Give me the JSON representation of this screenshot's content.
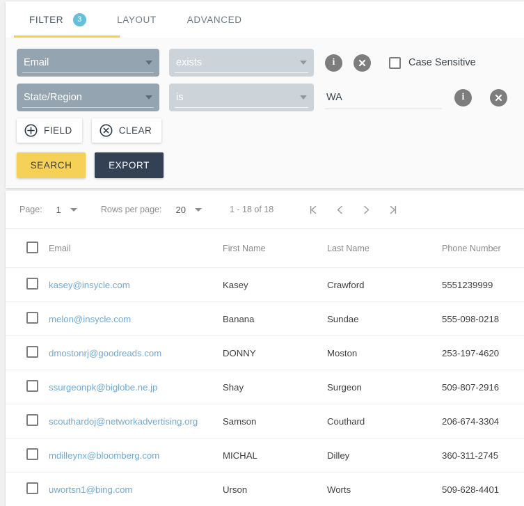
{
  "tabs": [
    {
      "label": "FILTER",
      "badge": "3",
      "active": true
    },
    {
      "label": "LAYOUT",
      "badge": "",
      "active": false
    },
    {
      "label": "ADVANCED",
      "badge": "",
      "active": false
    }
  ],
  "filters": [
    {
      "field": "Email",
      "operator": "exists",
      "value": "",
      "value_placeholder": ""
    },
    {
      "field": "State/Region",
      "operator": "is",
      "value": "WA",
      "value_placeholder": ""
    }
  ],
  "case_sensitive": {
    "label": "Case Sensitive",
    "checked": false
  },
  "buttons": {
    "field": "FIELD",
    "clear": "CLEAR",
    "search": "SEARCH",
    "export": "EXPORT"
  },
  "pagination": {
    "page_label": "Page:",
    "page_value": "1",
    "rows_label": "Rows per page:",
    "rows_value": "20",
    "range": "1 - 18 of 18"
  },
  "table": {
    "headers": [
      "Email",
      "First Name",
      "Last Name",
      "Phone Number"
    ],
    "rows": [
      {
        "email": "kasey@insycle.com",
        "first": "Kasey",
        "last": "Crawford",
        "phone": "5551239999"
      },
      {
        "email": "melon@insycle.com",
        "first": "Banana",
        "last": "Sundae",
        "phone": "555-098-0218"
      },
      {
        "email": "dmostonrj@goodreads.com",
        "first": "DONNY",
        "last": "Moston",
        "phone": "253-197-4620"
      },
      {
        "email": "ssurgeonpk@biglobe.ne.jp",
        "first": "Shay",
        "last": "Surgeon",
        "phone": "509-807-2916"
      },
      {
        "email": "scouthardoj@networkadvertising.org",
        "first": "Samson",
        "last": "Couthard",
        "phone": "206-674-3304"
      },
      {
        "email": "mdilleynx@bloomberg.com",
        "first": "MICHAL",
        "last": "Dilley",
        "phone": "360-311-2745"
      },
      {
        "email": "uwortsn1@bing.com",
        "first": "Urson",
        "last": "Worts",
        "phone": "509-628-4401"
      }
    ]
  },
  "colors": {
    "accent_yellow": "#f2ce4b",
    "badge_blue": "#62c0dd",
    "field_select": "#94a4b0",
    "operator_select": "#ccd4da",
    "export_dark": "#344155",
    "link_blue": "#70a9d4"
  }
}
